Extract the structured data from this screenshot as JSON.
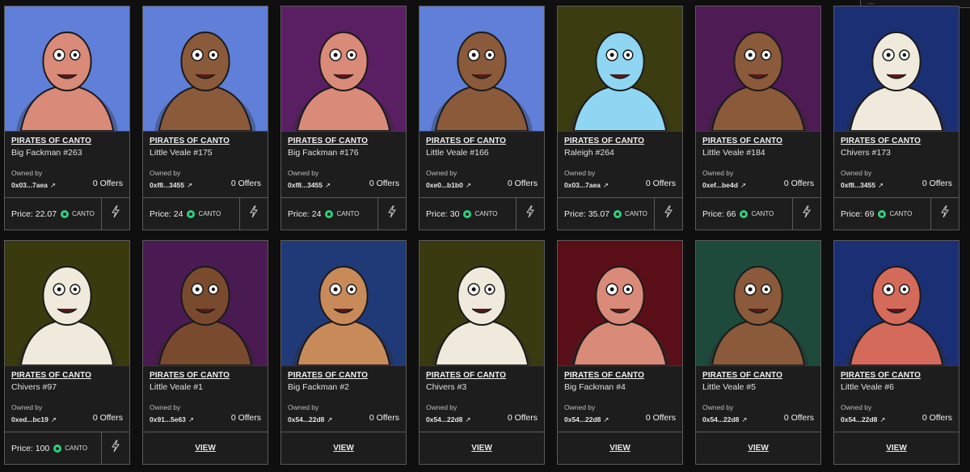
{
  "top_chip": {
    "text": "...."
  },
  "cards": [
    {
      "collection": "PIRATES OF CANTO",
      "token": "Big Fackman #263",
      "owned_label": "Owned by",
      "owner": "0x03...7aea",
      "offers": "0 Offers",
      "price": "Price: 22.07",
      "currency": "CANTO",
      "action": "bolt",
      "bg": "#5f7fd8"
    },
    {
      "collection": "PIRATES OF CANTO",
      "token": "Little Veale #175",
      "owned_label": "Owned by",
      "owner": "0xf8...3455",
      "offers": "0 Offers",
      "price": "Price: 24",
      "currency": "CANTO",
      "action": "bolt",
      "bg": "#5f7fd8"
    },
    {
      "collection": "PIRATES OF CANTO",
      "token": "Big Fackman #176",
      "owned_label": "Owned by",
      "owner": "0xf8...3455",
      "offers": "0 Offers",
      "price": "Price: 24",
      "currency": "CANTO",
      "action": "bolt",
      "bg": "#5a1f63"
    },
    {
      "collection": "PIRATES OF CANTO",
      "token": "Little Veale #166",
      "owned_label": "Owned by",
      "owner": "0xe0...b1b0",
      "offers": "0 Offers",
      "price": "Price: 30",
      "currency": "CANTO",
      "action": "bolt",
      "bg": "#5f7fd8"
    },
    {
      "collection": "PIRATES OF CANTO",
      "token": "Raleigh #264",
      "owned_label": "Owned by",
      "owner": "0x03...7aea",
      "offers": "0 Offers",
      "price": "Price: 35.07",
      "currency": "CANTO",
      "action": "bolt",
      "bg": "#3b3d10"
    },
    {
      "collection": "PIRATES OF CANTO",
      "token": "Little Veale #184",
      "owned_label": "Owned by",
      "owner": "0xef...be4d",
      "offers": "0 Offers",
      "price": "Price: 66",
      "currency": "CANTO",
      "action": "bolt",
      "bg": "#4e1b55"
    },
    {
      "collection": "PIRATES OF CANTO",
      "token": "Chivers #173",
      "owned_label": "Owned by",
      "owner": "0xf8...3455",
      "offers": "0 Offers",
      "price": "Price: 69",
      "currency": "CANTO",
      "action": "bolt",
      "bg": "#1b2f74"
    },
    {
      "collection": "PIRATES OF CANTO",
      "token": "Chivers #97",
      "owned_label": "Owned by",
      "owner": "0xed...bc19",
      "offers": "0 Offers",
      "price": "Price: 100",
      "currency": "CANTO",
      "action": "bolt",
      "bg": "#3a3a0f"
    },
    {
      "collection": "PIRATES OF CANTO",
      "token": "Little Veale #1",
      "owned_label": "Owned by",
      "owner": "0x91...5e63",
      "offers": "0 Offers",
      "view": "VIEW",
      "action": "view",
      "bg": "#4a1a52"
    },
    {
      "collection": "PIRATES OF CANTO",
      "token": "Big Fackman #2",
      "owned_label": "Owned by",
      "owner": "0x54...22d8",
      "offers": "0 Offers",
      "view": "VIEW",
      "action": "view",
      "bg": "#203a78"
    },
    {
      "collection": "PIRATES OF CANTO",
      "token": "Chivers #3",
      "owned_label": "Owned by",
      "owner": "0x54...22d8",
      "offers": "0 Offers",
      "view": "VIEW",
      "action": "view",
      "bg": "#3a3a10"
    },
    {
      "collection": "PIRATES OF CANTO",
      "token": "Big Fackman #4",
      "owned_label": "Owned by",
      "owner": "0x54...22d8",
      "offers": "0 Offers",
      "view": "VIEW",
      "action": "view",
      "bg": "#5a0f18"
    },
    {
      "collection": "PIRATES OF CANTO",
      "token": "Little Veale #5",
      "owned_label": "Owned by",
      "owner": "0x54...22d8",
      "offers": "0 Offers",
      "view": "VIEW",
      "action": "view",
      "bg": "#1d4a3a"
    },
    {
      "collection": "PIRATES OF CANTO",
      "token": "Little Veale #6",
      "owned_label": "Owned by",
      "owner": "0x54...22d8",
      "offers": "0 Offers",
      "view": "VIEW",
      "action": "view",
      "bg": "#1b2f74"
    }
  ]
}
